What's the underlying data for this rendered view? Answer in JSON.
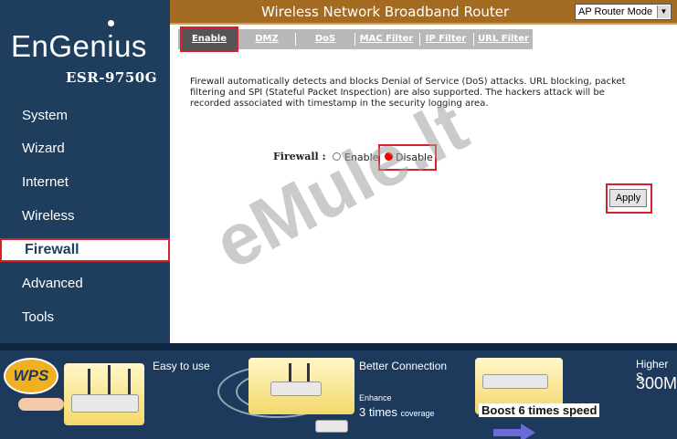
{
  "header": {
    "title": "Wireless Network Broadband Router",
    "mode_select": "AP Router Mode"
  },
  "sidebar": {
    "brand": "EnGenius",
    "model": "ESR-9750G",
    "items": [
      {
        "label": "System"
      },
      {
        "label": "Wizard"
      },
      {
        "label": "Internet"
      },
      {
        "label": "Wireless"
      },
      {
        "label": "Firewall",
        "active": true
      },
      {
        "label": "Advanced"
      },
      {
        "label": "Tools"
      }
    ]
  },
  "tabs": [
    {
      "label": "Enable",
      "active": true
    },
    {
      "label": "DMZ"
    },
    {
      "label": "DoS"
    },
    {
      "label": "MAC Filter"
    },
    {
      "label": "IP Filter"
    },
    {
      "label": "URL Filter"
    }
  ],
  "main": {
    "description_lines": [
      "Firewall automatically detects and blocks Denial of Service (DoS) attacks. URL blocking, packet",
      "filtering and SPI (Stateful Packet Inspection) are also supported. The hackers attack will be",
      "recorded associated with timestamp in the security logging area."
    ],
    "firewall_label": "Firewall :",
    "option_enable": "Enable",
    "option_disable": "Disable",
    "selected_option": "Disable",
    "apply_label": "Apply"
  },
  "watermark": "eMule.lt",
  "banner": {
    "wps": "WPS",
    "easy": "Easy to use",
    "better": "Better Connection",
    "enhance": "Enhance",
    "three_times": "3 times",
    "coverage": "coverage",
    "boost": "Boost 6 times speed",
    "higher": "Higher S",
    "mbps": "300M"
  },
  "colors": {
    "sidebar_bg": "#1f3e5e",
    "header_bg": "#a36a22",
    "highlight_red": "#d8202a",
    "radio_selected": "#ff0000"
  }
}
